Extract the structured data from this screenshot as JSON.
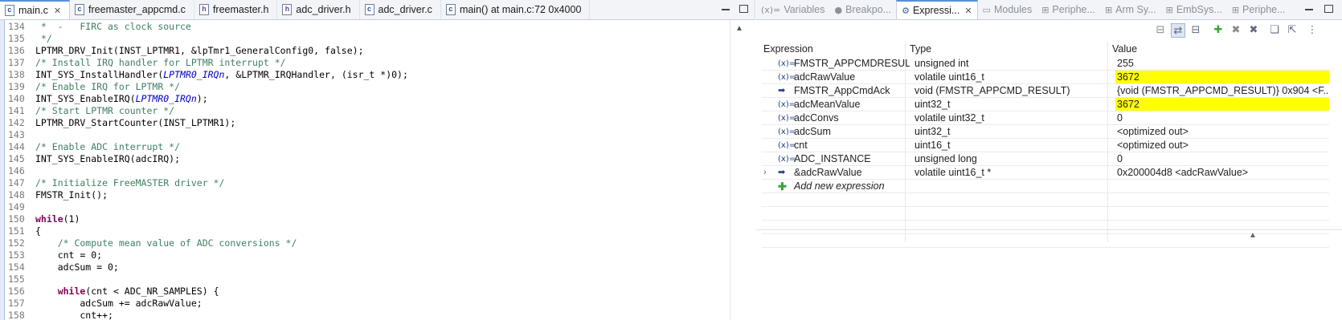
{
  "editor": {
    "tabs": [
      {
        "label": "main.c",
        "icon": "c-file-icon",
        "active": true
      },
      {
        "label": "freemaster_appcmd.c",
        "icon": "c-file-icon"
      },
      {
        "label": "freemaster.h",
        "icon": "h-file-icon"
      },
      {
        "label": "adc_driver.h",
        "icon": "h-file-icon"
      },
      {
        "label": "adc_driver.c",
        "icon": "c-file-icon"
      },
      {
        "label": "main() at main.c:72 0x4000",
        "icon": "c-file-icon"
      }
    ],
    "lines": [
      {
        "n": "134",
        "t": " *  -   FIRC as clock source",
        "k": "comment"
      },
      {
        "n": "135",
        "t": " */",
        "k": "comment"
      },
      {
        "n": "136",
        "t": "LPTMR_DRV_Init(INST_LPTMR1, &lpTmr1_GeneralConfig0, false);",
        "k": "code"
      },
      {
        "n": "137",
        "t": "/* Install IRQ handler for LPTMR interrupt */",
        "k": "comment"
      },
      {
        "n": "138",
        "t": "INT_SYS_InstallHandler(",
        "k": "code",
        "macro": "LPTMR0_IRQn",
        "rest": ", &LPTMR_IRQHandler, (isr_t *)0);"
      },
      {
        "n": "139",
        "t": "/* Enable IRQ for LPTMR */",
        "k": "comment"
      },
      {
        "n": "140",
        "t": "INT_SYS_EnableIRQ(",
        "k": "code",
        "macro": "LPTMR0_IRQn",
        "rest": ");"
      },
      {
        "n": "141",
        "t": "/* Start LPTMR counter */",
        "k": "comment"
      },
      {
        "n": "142",
        "t": "LPTMR_DRV_StartCounter(INST_LPTMR1);",
        "k": "code"
      },
      {
        "n": "143",
        "t": "",
        "k": "code"
      },
      {
        "n": "144",
        "t": "/* Enable ADC interrupt */",
        "k": "comment"
      },
      {
        "n": "145",
        "t": "INT_SYS_EnableIRQ(adcIRQ);",
        "k": "code"
      },
      {
        "n": "146",
        "t": "",
        "k": "code"
      },
      {
        "n": "147",
        "t": "/* Initialize FreeMASTER driver */",
        "k": "comment"
      },
      {
        "n": "148",
        "t": "FMSTR_Init();",
        "k": "code"
      },
      {
        "n": "149",
        "t": "",
        "k": "code"
      },
      {
        "n": "150",
        "t": "while",
        "k": "kw",
        "rest": "(1)"
      },
      {
        "n": "151",
        "t": "{",
        "k": "code"
      },
      {
        "n": "152",
        "t": "    /* Compute mean value of ADC conversions */",
        "k": "comment"
      },
      {
        "n": "153",
        "t": "    cnt = 0;",
        "k": "code"
      },
      {
        "n": "154",
        "t": "    adcSum = 0;",
        "k": "code"
      },
      {
        "n": "155",
        "t": "",
        "k": "code"
      },
      {
        "n": "156",
        "t": "    ",
        "k": "kwind",
        "kw": "while",
        "rest": "(cnt < ADC_NR_SAMPLES) {"
      },
      {
        "n": "157",
        "t": "        adcSum += adcRawValue;",
        "k": "code"
      },
      {
        "n": "158",
        "t": "        cnt++;",
        "k": "code"
      }
    ]
  },
  "expressions": {
    "tabs": [
      {
        "label": "Variables",
        "icon": "(x)="
      },
      {
        "label": "Breakpo...",
        "icon": "●"
      },
      {
        "label": "Expressi...",
        "icon": "⚙",
        "active": true
      },
      {
        "label": "Modules",
        "icon": "▭"
      },
      {
        "label": "Periphe...",
        "icon": "⊞"
      },
      {
        "label": "Arm Sy...",
        "icon": "⊞"
      },
      {
        "label": "EmbSys...",
        "icon": "⊞"
      },
      {
        "label": "Periphe...",
        "icon": "⊞"
      }
    ],
    "headers": {
      "expression": "Expression",
      "type": "Type",
      "value": "Value"
    },
    "rows": [
      {
        "icon": "(x)=",
        "expr": "FMSTR_APPCMDRESULT_N",
        "type": "unsigned int",
        "value": "255",
        "hl": false
      },
      {
        "icon": "(x)=",
        "expr": "adcRawValue",
        "type": "volatile uint16_t",
        "value": "3672",
        "hl": true
      },
      {
        "icon": "➡",
        "expr": "FMSTR_AppCmdAck",
        "type": "void (FMSTR_APPCMD_RESULT)",
        "value": "{void (FMSTR_APPCMD_RESULT)} 0x904 <F...",
        "hl": false
      },
      {
        "icon": "(x)=",
        "expr": "adcMeanValue",
        "type": "uint32_t",
        "value": "3672",
        "hl": true
      },
      {
        "icon": "(x)=",
        "expr": "adcConvs",
        "type": "volatile uint32_t",
        "value": "0",
        "hl": false
      },
      {
        "icon": "(x)=",
        "expr": "adcSum",
        "type": "uint32_t",
        "value": "<optimized out>",
        "hl": false
      },
      {
        "icon": "(x)=",
        "expr": "cnt",
        "type": "uint16_t",
        "value": "<optimized out>",
        "hl": false
      },
      {
        "icon": "(x)=",
        "expr": "ADC_INSTANCE",
        "type": "unsigned long",
        "value": "0",
        "hl": false
      },
      {
        "icon": "➡",
        "expr": "&adcRawValue",
        "type": "volatile uint16_t *",
        "value": "0x200004d8 <adcRawValue>",
        "hl": false,
        "expandable": true
      }
    ],
    "add_label": "Add new expression"
  }
}
